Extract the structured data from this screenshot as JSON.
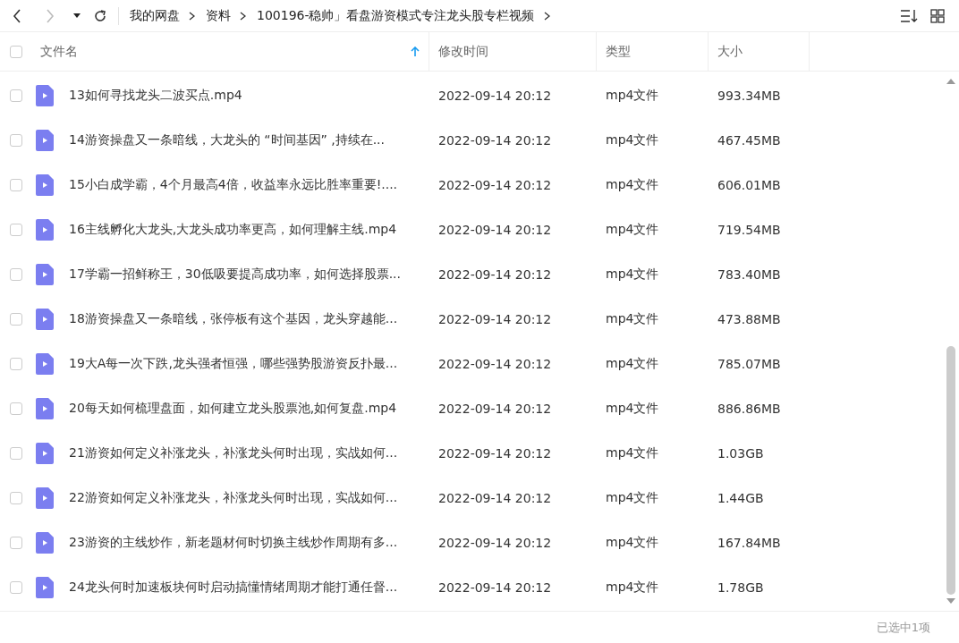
{
  "breadcrumb": [
    "我的网盘",
    "资料",
    "100196-稳帅」看盘游资模式专注龙头股专栏视频"
  ],
  "columns": [
    {
      "label": "文件名",
      "sorted": true
    },
    {
      "label": "修改时间",
      "sorted": false
    },
    {
      "label": "类型",
      "sorted": false
    },
    {
      "label": "大小",
      "sorted": false
    }
  ],
  "select_all": {
    "checked": false
  },
  "rows": [
    {
      "name": "13如何寻找龙头二波买点.mp4",
      "modified": "2022-09-14 20:12",
      "type": "mp4文件",
      "size": "993.34MB",
      "checked": false
    },
    {
      "name": "14游资操盘又一条暗线，大龙头的 “时间基因” ,持续在...",
      "modified": "2022-09-14 20:12",
      "type": "mp4文件",
      "size": "467.45MB",
      "checked": false
    },
    {
      "name": "15小白成学霸，4个月最高4倍，收益率永远比胜率重要!....",
      "modified": "2022-09-14 20:12",
      "type": "mp4文件",
      "size": "606.01MB",
      "checked": false
    },
    {
      "name": "16主线孵化大龙头,大龙头成功率更高，如何理解主线.mp4",
      "modified": "2022-09-14 20:12",
      "type": "mp4文件",
      "size": "719.54MB",
      "checked": false
    },
    {
      "name": "17学霸一招鲜称王，30低吸要提高成功率，如何选择股票...",
      "modified": "2022-09-14 20:12",
      "type": "mp4文件",
      "size": "783.40MB",
      "checked": false
    },
    {
      "name": "18游资操盘又一条暗线，张停板有这个基因，龙头穿越能...",
      "modified": "2022-09-14 20:12",
      "type": "mp4文件",
      "size": "473.88MB",
      "checked": false
    },
    {
      "name": "19大A每一次下跌,龙头强者恒强，哪些强势股游资反扑最...",
      "modified": "2022-09-14 20:12",
      "type": "mp4文件",
      "size": "785.07MB",
      "checked": false
    },
    {
      "name": "20每天如何梳理盘面，如何建立龙头股票池,如何复盘.mp4",
      "modified": "2022-09-14 20:12",
      "type": "mp4文件",
      "size": "886.86MB",
      "checked": false
    },
    {
      "name": "21游资如何定义补涨龙头，补涨龙头何时出现，实战如何...",
      "modified": "2022-09-14 20:12",
      "type": "mp4文件",
      "size": "1.03GB",
      "checked": false
    },
    {
      "name": "22游资如何定义补涨龙头，补涨龙头何时出现，实战如何...",
      "modified": "2022-09-14 20:12",
      "type": "mp4文件",
      "size": "1.44GB",
      "checked": false
    },
    {
      "name": "23游资的主线炒作，新老题材何时切换主线炒作周期有多...",
      "modified": "2022-09-14 20:12",
      "type": "mp4文件",
      "size": "167.84MB",
      "checked": false
    },
    {
      "name": "24龙头何时加速板块何时启动搞懂情绪周期才能打通任督...",
      "modified": "2022-09-14 20:12",
      "type": "mp4文件",
      "size": "1.78GB",
      "checked": false
    }
  ],
  "status": "已选中1项"
}
